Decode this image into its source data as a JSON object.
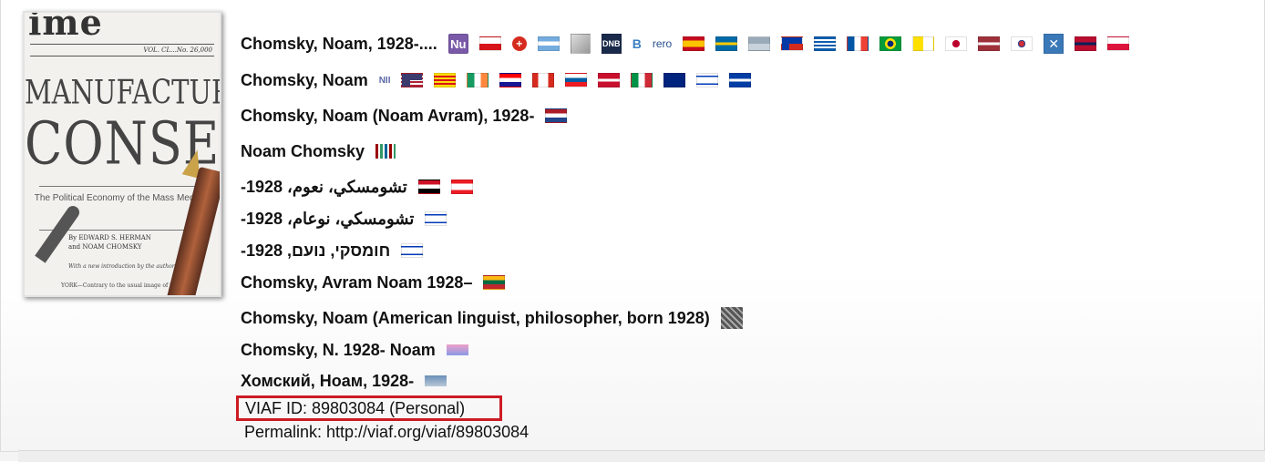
{
  "cover": {
    "masthead": "ime",
    "issue": "VOL. CL...No. 26,000",
    "title_line1": "MANUFACTURING",
    "title_line2": "CONSENT",
    "subtitle": "The Political Economy of the Mass Media",
    "byline1": "By EDWARD S. HERMAN",
    "byline2": "and NOAM CHOMSKY",
    "intro": "With a new introduction by the authors",
    "footer": "YORK—Contrary to the usual image of the"
  },
  "headings": [
    {
      "text": "Chomsky, Noam, 1928-....",
      "flags": [
        "nukat-icon",
        "czech-flag",
        "swiss-flag",
        "argentina-flag",
        "stack-icon",
        "dnb-icon",
        "b-icon",
        "rero-icon",
        "spain-flag",
        "sweden-flag",
        "estonia-flag",
        "chile-flag",
        "greece-flag",
        "france-flag",
        "brazil-flag",
        "vatican-flag",
        "japan-flag",
        "latvia-flag",
        "korea-flag",
        "x-icon",
        "norway-flag",
        "poland-flag"
      ]
    },
    {
      "text": "Chomsky, Noam",
      "flags": [
        "nii-icon",
        "usa-flag",
        "catalonia-flag",
        "ireland-flag",
        "croatia-flag",
        "canada-flag",
        "slovenia-flag",
        "denmark-flag",
        "italy-flag",
        "australia-flag",
        "israel-flag",
        "quebec-flag"
      ]
    },
    {
      "text": "Chomsky, Noam (Noam Avram), 1928-",
      "flags": [
        "netherlands-flag"
      ]
    },
    {
      "text": "Noam Chomsky",
      "flags": [
        "wikidata-icon"
      ]
    },
    {
      "text": "تشومسكي، نعوم، 1928-",
      "flags": [
        "egypt-flag",
        "lebanon-flag"
      ]
    },
    {
      "text": "تشومسكي، نوعام، 1928-",
      "flags": [
        "israel-flag"
      ]
    },
    {
      "text": "חומסקי, נועם, 1928-",
      "flags": [
        "israel-flag"
      ]
    },
    {
      "text": "Chomsky, Avram Noam 1928–",
      "flags": [
        "lithuania-flag"
      ]
    },
    {
      "text": "Chomsky, Noam (American linguist, philosopher, born 1928)",
      "flags": [
        "isni-icon"
      ]
    },
    {
      "text": "Chomsky, N. 1928- Noam",
      "flags": [
        "gradient-flag"
      ]
    },
    {
      "text": "Хомский, Ноам, 1928-",
      "flags": [
        "belarus-flag"
      ]
    }
  ],
  "icon_labels": {
    "nukat": "Nu",
    "dnb": "DNB",
    "b": "B",
    "rero": "rero",
    "nii": "NII",
    "x": "✕"
  },
  "viaf_id": "VIAF ID: 89803084 (Personal)",
  "permalink": "Permalink: http://viaf.org/viaf/89803084",
  "colors": {
    "highlight_border": "#cc1b24"
  }
}
